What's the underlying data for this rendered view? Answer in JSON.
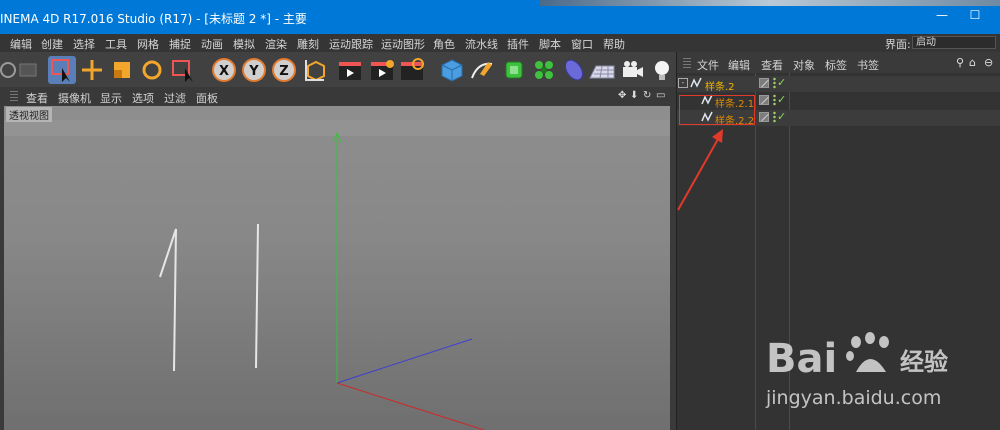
{
  "window": {
    "title": "INEMA 4D R17.016 Studio (R17) - [未标题 2 *] - 主要",
    "minimize_symbol": "—",
    "maximize_symbol": "☐"
  },
  "menubar": {
    "items": [
      "编辑",
      "创建",
      "选择",
      "工具",
      "网格",
      "捕捉",
      "动画",
      "模拟",
      "渲染",
      "雕刻",
      "运动跟踪",
      "运动图形",
      "角色",
      "流水线",
      "插件",
      "脚本",
      "窗口",
      "帮助"
    ],
    "layout_label": "界面:",
    "layout_value": "启动"
  },
  "toolbar": {
    "tools": [
      "undo-icon",
      "live-selection-icon",
      "move-icon",
      "scale-icon",
      "rotate-icon",
      "last-selection-icon",
      "x-axis-lock-icon",
      "y-axis-lock-icon",
      "z-axis-lock-icon",
      "coordinate-system-icon",
      "render-view-icon",
      "render-picture-viewer-icon",
      "render-settings-icon",
      "cube-icon",
      "pen-spline-icon",
      "subdivision-surface-icon",
      "cloner-icon",
      "deformer-icon",
      "floor-icon",
      "camera-icon",
      "light-icon"
    ],
    "axis_labels": [
      "X",
      "Y",
      "Z"
    ]
  },
  "viewport": {
    "menu": [
      "查看",
      "摄像机",
      "显示",
      "选项",
      "过滤",
      "面板"
    ],
    "view_label": "透视视图",
    "nav_controls": [
      "✥",
      "⬇",
      "↻",
      "▭"
    ]
  },
  "object_manager": {
    "menu": [
      "文件",
      "编辑",
      "查看",
      "对象",
      "标签",
      "书签"
    ],
    "tree": [
      {
        "name": "样条.2",
        "level": 0,
        "expander": "-"
      },
      {
        "name": "样条.2.1",
        "level": 1
      },
      {
        "name": "样条.2.2",
        "level": 1
      }
    ],
    "check_symbol": "✓"
  },
  "watermark": {
    "brand": "Bai",
    "brand_suffix": "经验",
    "url": "jingyan.baidu.com"
  },
  "colors": {
    "titlebar": "#0078d7",
    "object_name": "#f0b400",
    "highlight_box": "#e23a2a",
    "y_axis": "#3bbf3b",
    "x_axis": "#cc2a2a",
    "z_axis": "#4040cc"
  }
}
